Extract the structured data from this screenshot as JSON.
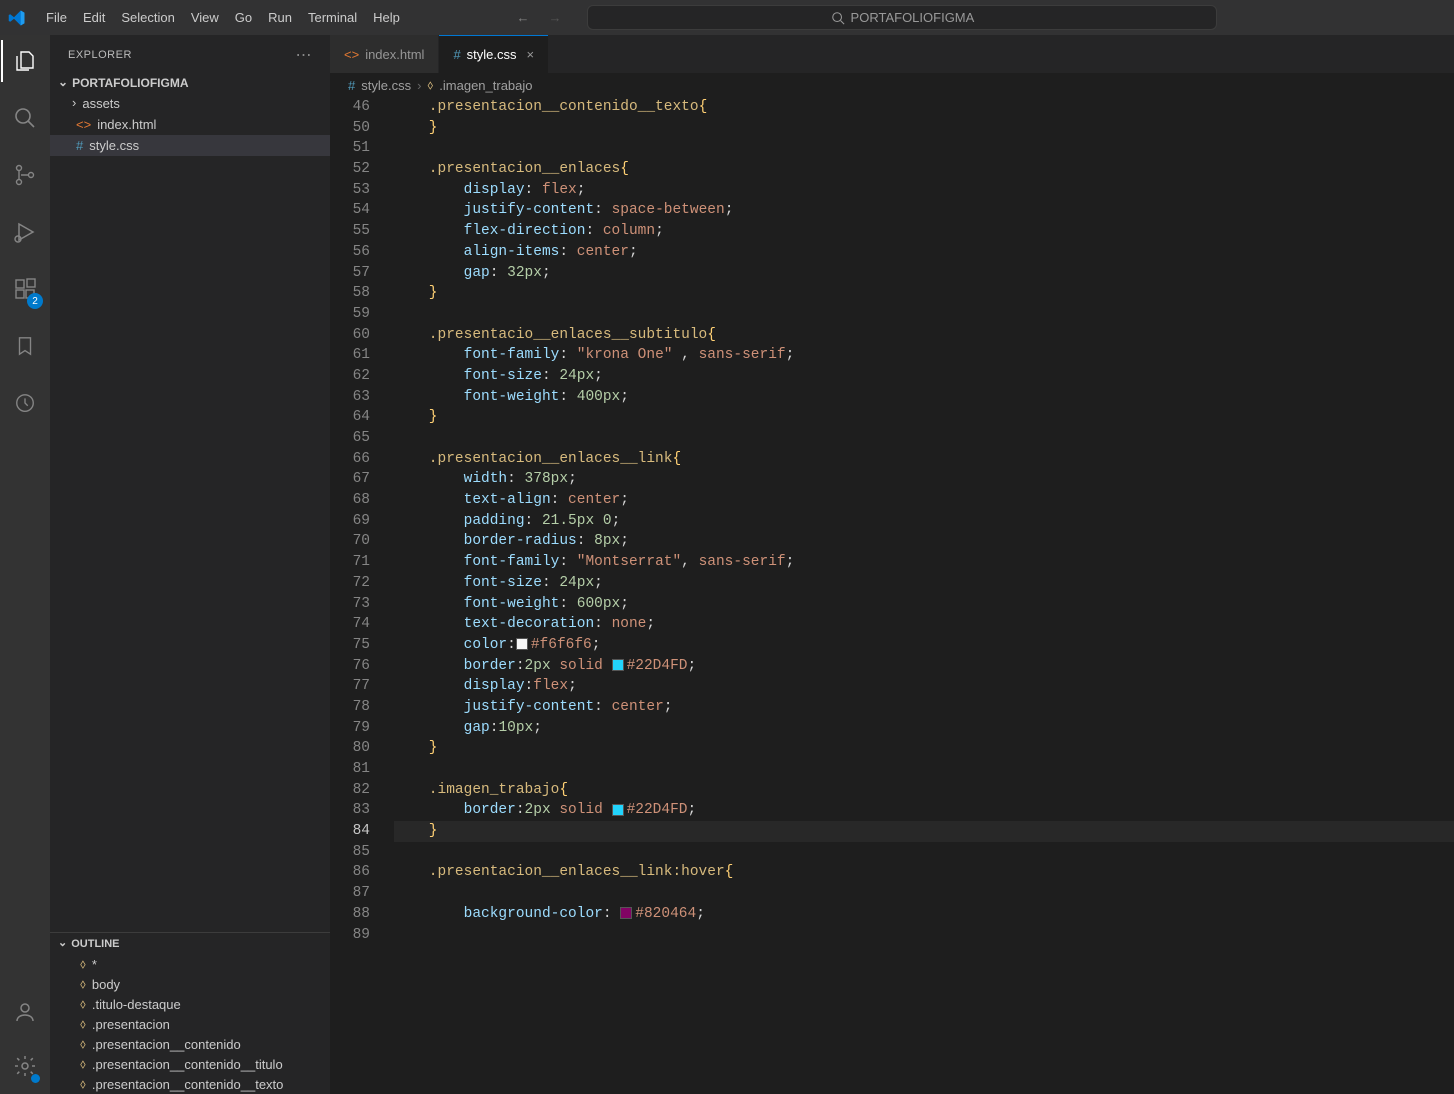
{
  "titlebar": {
    "menu": [
      "File",
      "Edit",
      "Selection",
      "View",
      "Go",
      "Run",
      "Terminal",
      "Help"
    ],
    "search": "PORTAFOLIOFIGMA"
  },
  "sidebar": {
    "title": "EXPLORER",
    "project": "PORTAFOLIOFIGMA",
    "files": {
      "assets": "assets",
      "index": "index.html",
      "style": "style.css"
    },
    "outline_title": "OUTLINE",
    "outline": [
      "*",
      "body",
      ".titulo-destaque",
      ".presentacion",
      ".presentacion__contenido",
      ".presentacion__contenido__titulo",
      ".presentacion__contenido__texto"
    ]
  },
  "tabs": {
    "index": "index.html",
    "style": "style.css"
  },
  "breadcrumbs": {
    "file": "style.css",
    "symbol": ".imagen_trabajo"
  },
  "badge_extensions": "2",
  "code": {
    "first_line": "46",
    "lines": [
      {
        "n": 46,
        "seg": [
          {
            "c": "y",
            "t": "    .presentacion__contenido__texto"
          },
          {
            "c": "gr",
            "t": "{"
          }
        ]
      },
      {
        "n": 50,
        "seg": [
          {
            "c": "gr",
            "t": "    }"
          }
        ]
      },
      {
        "n": 51,
        "seg": [
          {
            "c": "w",
            "t": ""
          }
        ]
      },
      {
        "n": 52,
        "seg": [
          {
            "c": "y",
            "t": "    .presentacion__enlaces"
          },
          {
            "c": "gr",
            "t": "{"
          }
        ]
      },
      {
        "n": 53,
        "seg": [
          {
            "c": "w",
            "t": "        "
          },
          {
            "c": "b",
            "t": "display"
          },
          {
            "c": "w",
            "t": ": "
          },
          {
            "c": "o",
            "t": "flex"
          },
          {
            "c": "w",
            "t": ";"
          }
        ]
      },
      {
        "n": 54,
        "seg": [
          {
            "c": "w",
            "t": "        "
          },
          {
            "c": "b",
            "t": "justify-content"
          },
          {
            "c": "w",
            "t": ": "
          },
          {
            "c": "o",
            "t": "space-between"
          },
          {
            "c": "w",
            "t": ";"
          }
        ]
      },
      {
        "n": 55,
        "seg": [
          {
            "c": "w",
            "t": "        "
          },
          {
            "c": "b",
            "t": "flex-direction"
          },
          {
            "c": "w",
            "t": ": "
          },
          {
            "c": "o",
            "t": "column"
          },
          {
            "c": "w",
            "t": ";"
          }
        ]
      },
      {
        "n": 56,
        "seg": [
          {
            "c": "w",
            "t": "        "
          },
          {
            "c": "b",
            "t": "align-items"
          },
          {
            "c": "w",
            "t": ": "
          },
          {
            "c": "o",
            "t": "center"
          },
          {
            "c": "w",
            "t": ";"
          }
        ]
      },
      {
        "n": 57,
        "seg": [
          {
            "c": "w",
            "t": "        "
          },
          {
            "c": "b",
            "t": "gap"
          },
          {
            "c": "w",
            "t": ": "
          },
          {
            "c": "g",
            "t": "32px"
          },
          {
            "c": "w",
            "t": ";"
          }
        ]
      },
      {
        "n": 58,
        "seg": [
          {
            "c": "gr",
            "t": "    }"
          }
        ]
      },
      {
        "n": 59,
        "seg": [
          {
            "c": "w",
            "t": ""
          }
        ]
      },
      {
        "n": 60,
        "seg": [
          {
            "c": "y",
            "t": "    .presentacio__enlaces__subtitulo"
          },
          {
            "c": "gr",
            "t": "{"
          }
        ]
      },
      {
        "n": 61,
        "seg": [
          {
            "c": "w",
            "t": "        "
          },
          {
            "c": "b",
            "t": "font-family"
          },
          {
            "c": "w",
            "t": ": "
          },
          {
            "c": "o",
            "t": "\"krona One\" "
          },
          {
            "c": "w",
            "t": ", "
          },
          {
            "c": "o",
            "t": "sans-serif"
          },
          {
            "c": "w",
            "t": ";"
          }
        ]
      },
      {
        "n": 62,
        "seg": [
          {
            "c": "w",
            "t": "        "
          },
          {
            "c": "b",
            "t": "font-size"
          },
          {
            "c": "w",
            "t": ": "
          },
          {
            "c": "g",
            "t": "24px"
          },
          {
            "c": "w",
            "t": ";"
          }
        ]
      },
      {
        "n": 63,
        "seg": [
          {
            "c": "w",
            "t": "        "
          },
          {
            "c": "b",
            "t": "font-weight"
          },
          {
            "c": "w",
            "t": ": "
          },
          {
            "c": "g",
            "t": "400px"
          },
          {
            "c": "w",
            "t": ";"
          }
        ]
      },
      {
        "n": 64,
        "seg": [
          {
            "c": "gr",
            "t": "    }"
          }
        ]
      },
      {
        "n": 65,
        "seg": [
          {
            "c": "w",
            "t": ""
          }
        ]
      },
      {
        "n": 66,
        "seg": [
          {
            "c": "y",
            "t": "    .presentacion__enlaces__link"
          },
          {
            "c": "gr",
            "t": "{"
          }
        ]
      },
      {
        "n": 67,
        "seg": [
          {
            "c": "w",
            "t": "        "
          },
          {
            "c": "b",
            "t": "width"
          },
          {
            "c": "w",
            "t": ": "
          },
          {
            "c": "g",
            "t": "378px"
          },
          {
            "c": "w",
            "t": ";"
          }
        ]
      },
      {
        "n": 68,
        "seg": [
          {
            "c": "w",
            "t": "        "
          },
          {
            "c": "b",
            "t": "text-align"
          },
          {
            "c": "w",
            "t": ": "
          },
          {
            "c": "o",
            "t": "center"
          },
          {
            "c": "w",
            "t": ";"
          }
        ]
      },
      {
        "n": 69,
        "seg": [
          {
            "c": "w",
            "t": "        "
          },
          {
            "c": "b",
            "t": "padding"
          },
          {
            "c": "w",
            "t": ": "
          },
          {
            "c": "g",
            "t": "21.5px"
          },
          {
            "c": "w",
            "t": " "
          },
          {
            "c": "g",
            "t": "0"
          },
          {
            "c": "w",
            "t": ";"
          }
        ]
      },
      {
        "n": 70,
        "seg": [
          {
            "c": "w",
            "t": "        "
          },
          {
            "c": "b",
            "t": "border-radius"
          },
          {
            "c": "w",
            "t": ": "
          },
          {
            "c": "g",
            "t": "8px"
          },
          {
            "c": "w",
            "t": ";"
          }
        ]
      },
      {
        "n": 71,
        "seg": [
          {
            "c": "w",
            "t": "        "
          },
          {
            "c": "b",
            "t": "font-family"
          },
          {
            "c": "w",
            "t": ": "
          },
          {
            "c": "o",
            "t": "\"Montserrat\""
          },
          {
            "c": "w",
            "t": ", "
          },
          {
            "c": "o",
            "t": "sans-serif"
          },
          {
            "c": "w",
            "t": ";"
          }
        ]
      },
      {
        "n": 72,
        "seg": [
          {
            "c": "w",
            "t": "        "
          },
          {
            "c": "b",
            "t": "font-size"
          },
          {
            "c": "w",
            "t": ": "
          },
          {
            "c": "g",
            "t": "24px"
          },
          {
            "c": "w",
            "t": ";"
          }
        ]
      },
      {
        "n": 73,
        "seg": [
          {
            "c": "w",
            "t": "        "
          },
          {
            "c": "b",
            "t": "font-weight"
          },
          {
            "c": "w",
            "t": ": "
          },
          {
            "c": "g",
            "t": "600px"
          },
          {
            "c": "w",
            "t": ";"
          }
        ]
      },
      {
        "n": 74,
        "seg": [
          {
            "c": "w",
            "t": "        "
          },
          {
            "c": "b",
            "t": "text-decoration"
          },
          {
            "c": "w",
            "t": ": "
          },
          {
            "c": "o",
            "t": "none"
          },
          {
            "c": "w",
            "t": ";"
          }
        ]
      },
      {
        "n": 75,
        "seg": [
          {
            "c": "w",
            "t": "        "
          },
          {
            "c": "b",
            "t": "color"
          },
          {
            "c": "w",
            "t": ":"
          },
          {
            "c": "sw",
            "t": "#f6f6f6"
          },
          {
            "c": "o",
            "t": "#f6f6f6"
          },
          {
            "c": "w",
            "t": ";"
          }
        ]
      },
      {
        "n": 76,
        "seg": [
          {
            "c": "w",
            "t": "        "
          },
          {
            "c": "b",
            "t": "border"
          },
          {
            "c": "w",
            "t": ":"
          },
          {
            "c": "g",
            "t": "2px"
          },
          {
            "c": "w",
            "t": " "
          },
          {
            "c": "o",
            "t": "solid"
          },
          {
            "c": "w",
            "t": " "
          },
          {
            "c": "sw",
            "t": "#22D4FD"
          },
          {
            "c": "o",
            "t": "#22D4FD"
          },
          {
            "c": "w",
            "t": ";"
          }
        ]
      },
      {
        "n": 77,
        "seg": [
          {
            "c": "w",
            "t": "        "
          },
          {
            "c": "b",
            "t": "display"
          },
          {
            "c": "w",
            "t": ":"
          },
          {
            "c": "o",
            "t": "flex"
          },
          {
            "c": "w",
            "t": ";"
          }
        ]
      },
      {
        "n": 78,
        "seg": [
          {
            "c": "w",
            "t": "        "
          },
          {
            "c": "b",
            "t": "justify-content"
          },
          {
            "c": "w",
            "t": ": "
          },
          {
            "c": "o",
            "t": "center"
          },
          {
            "c": "w",
            "t": ";"
          }
        ]
      },
      {
        "n": 79,
        "seg": [
          {
            "c": "w",
            "t": "        "
          },
          {
            "c": "b",
            "t": "gap"
          },
          {
            "c": "w",
            "t": ":"
          },
          {
            "c": "g",
            "t": "10px"
          },
          {
            "c": "w",
            "t": ";"
          }
        ]
      },
      {
        "n": 80,
        "seg": [
          {
            "c": "gr",
            "t": "    }"
          }
        ]
      },
      {
        "n": 81,
        "seg": [
          {
            "c": "w",
            "t": ""
          }
        ]
      },
      {
        "n": 82,
        "seg": [
          {
            "c": "y",
            "t": "    .imagen_trabajo"
          },
          {
            "c": "gr",
            "t": "{"
          }
        ]
      },
      {
        "n": 83,
        "seg": [
          {
            "c": "w",
            "t": "        "
          },
          {
            "c": "b",
            "t": "border"
          },
          {
            "c": "w",
            "t": ":"
          },
          {
            "c": "g",
            "t": "2px"
          },
          {
            "c": "w",
            "t": " "
          },
          {
            "c": "o",
            "t": "solid"
          },
          {
            "c": "w",
            "t": " "
          },
          {
            "c": "sw",
            "t": "#22D4FD"
          },
          {
            "c": "o",
            "t": "#22D4FD"
          },
          {
            "c": "w",
            "t": ";"
          }
        ]
      },
      {
        "n": 84,
        "hl": true,
        "seg": [
          {
            "c": "gr",
            "t": "    }"
          }
        ]
      },
      {
        "n": 85,
        "seg": [
          {
            "c": "w",
            "t": ""
          }
        ]
      },
      {
        "n": 86,
        "seg": [
          {
            "c": "y",
            "t": "    .presentacion__enlaces__link:hover"
          },
          {
            "c": "gr",
            "t": "{"
          }
        ]
      },
      {
        "n": 87,
        "seg": [
          {
            "c": "w",
            "t": ""
          }
        ]
      },
      {
        "n": 88,
        "seg": [
          {
            "c": "w",
            "t": "        "
          },
          {
            "c": "b",
            "t": "background-color"
          },
          {
            "c": "w",
            "t": ": "
          },
          {
            "c": "sw",
            "t": "#820464"
          },
          {
            "c": "o",
            "t": "#820464"
          },
          {
            "c": "w",
            "t": ";"
          }
        ]
      },
      {
        "n": 89,
        "seg": [
          {
            "c": "w",
            "t": ""
          }
        ]
      }
    ]
  }
}
